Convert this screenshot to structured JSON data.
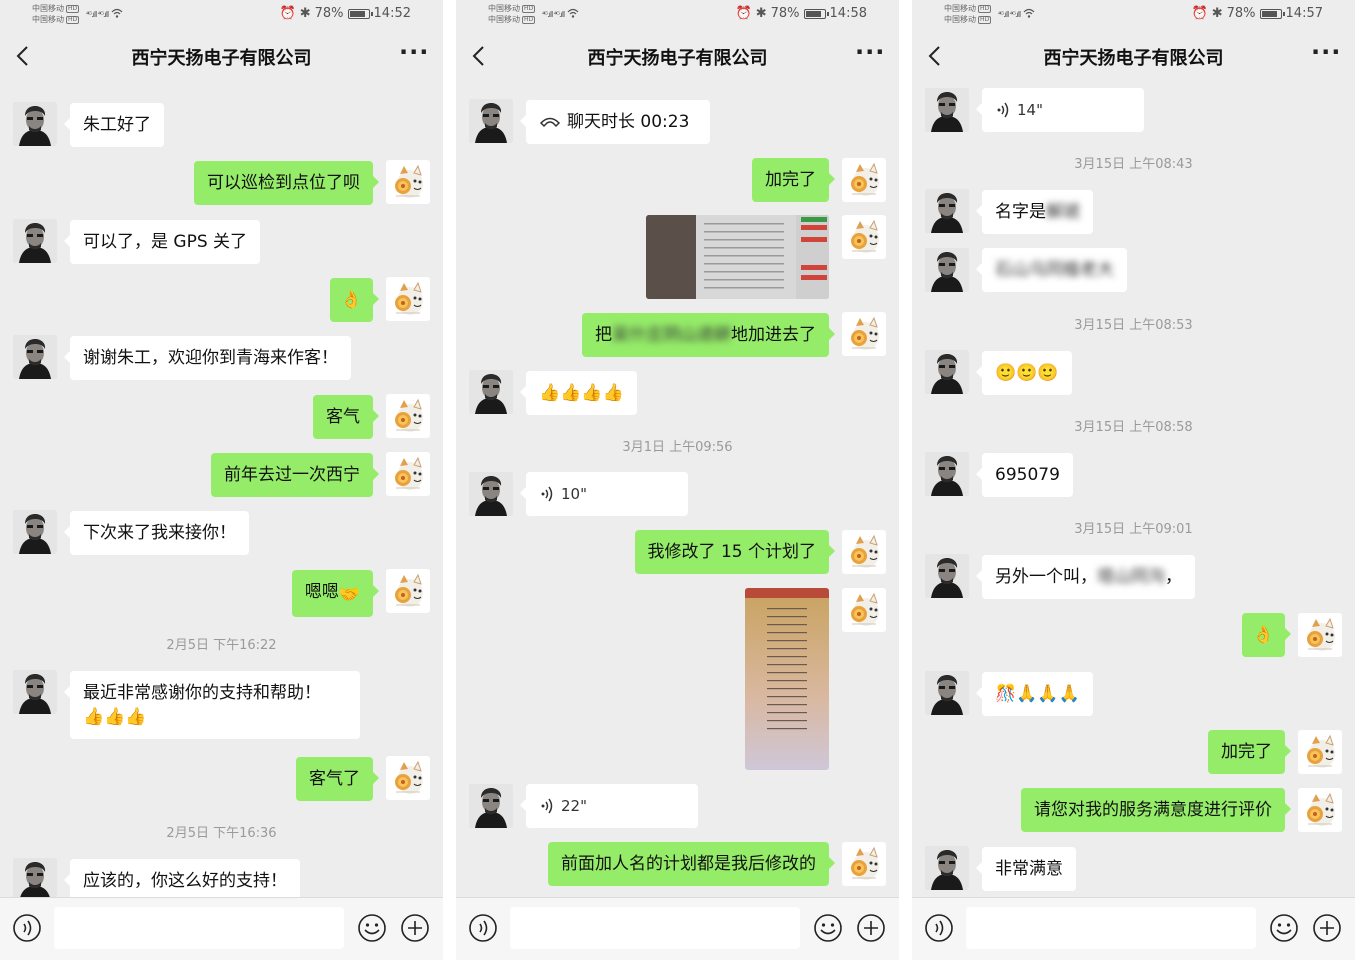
{
  "status": {
    "carrier_line1": "中国移动",
    "carrier_line2": "中国移动",
    "hd": "HD",
    "signal": "⁴ᴳ.ıll ⁴ᴳ.ıll",
    "battery": "78%"
  },
  "screens": [
    {
      "time": "14:52",
      "title": "西宁天扬电子有限公司",
      "messages": {
        "m1": "朱工好了",
        "m2": "可以巡检到点位了呗",
        "m3": "可以了，是 GPS 关了",
        "m4_emoji": "👌",
        "m5": "谢谢朱工，欢迎你到青海来作客！",
        "m6": "客气",
        "m7": "前年去过一次西宁",
        "m8": "下次来了我来接你！",
        "m9": "嗯嗯",
        "m9_emoji": "🤝",
        "ts1": "2月5日 下午16:22",
        "m10": "最近非常感谢你的支持和帮助！",
        "m10_emoji": "👍👍👍",
        "m11": "客气了",
        "ts2": "2月5日 下午16:36",
        "m12": "应该的，你这么好的支持！"
      }
    },
    {
      "time": "14:58",
      "title": "西宁天扬电子有限公司",
      "messages": {
        "call": "聊天时长 00:23",
        "m1": "加完了",
        "m2_pre": "把",
        "m2_blur": "吴什庄阴山退耕",
        "m2_post": "地加进去了",
        "m3_emoji": "👍👍👍👍",
        "ts1": "3月1日 上午09:56",
        "voice1": "10\"",
        "m4": "我修改了 15 个计划了",
        "voice2": "22\"",
        "m5": "前面加人名的计划都是我后修改的"
      }
    },
    {
      "time": "14:57",
      "title": "西宁天扬电子有限公司",
      "messages": {
        "voice1": "14\"",
        "ts1": "3月15日 上午08:43",
        "m1_pre": "名字是",
        "m1_blur": "解琥",
        "m2_blur": "石山乌同植老大",
        "ts2": "3月15日 上午08:53",
        "m3_emoji": "🙂🙂🙂",
        "ts3": "3月15日 上午08:58",
        "m4": "695079",
        "ts4": "3月15日 上午09:01",
        "m5_pre": "另外一个叫，",
        "m5_blur": "塔山同沟",
        "m5_post": "，",
        "m6_emoji": "👌",
        "m7_emoji": "🎊🙏🙏🙏",
        "m8": "加完了",
        "m9": "请您对我的服务满意度进行评价",
        "m10": "非常满意"
      }
    }
  ],
  "colors": {
    "bg": "#ededed",
    "bubble_self": "#95ec69",
    "bubble_other": "#ffffff",
    "timestamp": "#9a9a9a"
  }
}
